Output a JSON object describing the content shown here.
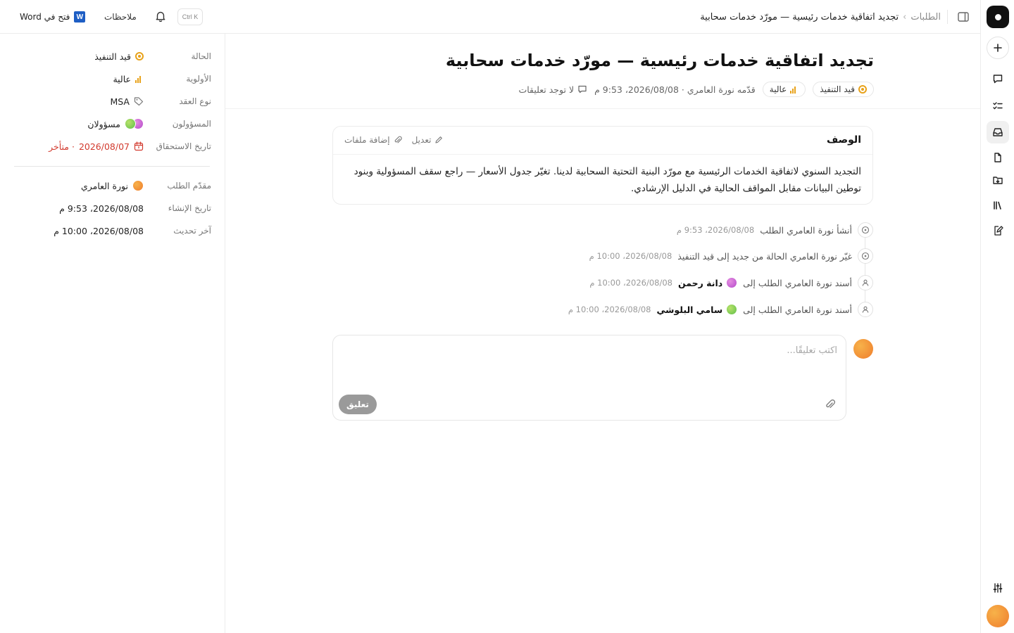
{
  "topbar": {
    "breadcrumb_parent": "الطلبات",
    "breadcrumb_separator": "›",
    "breadcrumb_current": "تجديد اتفاقية خدمات رئيسية — مورّد خدمات سحابية",
    "shortcut_hint": "Ctrl K",
    "notes_label": "ملاحظات",
    "open_in_word_label": "فتح في Word",
    "word_icon_letter": "W"
  },
  "properties": {
    "status": {
      "label": "الحالة",
      "value": "قيد التنفيذ",
      "color": "#e8a21a"
    },
    "priority": {
      "label": "الأولوية",
      "value": "عالية"
    },
    "contract_type": {
      "label": "نوع العقد",
      "value": "MSA"
    },
    "assignees": {
      "label": "المسؤولون",
      "value": "مسؤولان"
    },
    "due_date": {
      "label": "تاريخ الاستحقاق",
      "value": "2026/08/07",
      "overdue": "· متأخر",
      "color": "#d23a2e"
    },
    "requester": {
      "label": "مقدّم الطلب",
      "value": "نورة العامري"
    },
    "created": {
      "label": "تاريخ الإنشاء",
      "value": "2026/08/08، 9:53 م"
    },
    "updated": {
      "label": "آخر تحديث",
      "value": "2026/08/08، 10:00 م"
    }
  },
  "header": {
    "title": "تجديد اتفاقية خدمات رئيسية — مورّد خدمات سحابية",
    "status_pill": "قيد التنفيذ",
    "priority_pill": "عالية",
    "submitted_by": "قدّمه نورة العامري · 2026/08/08، 9:53 م",
    "comments_count": "لا توجد تعليقات"
  },
  "description": {
    "heading": "الوصف",
    "edit_label": "تعديل",
    "attach_label": "إضافة ملفات",
    "body": "التجديد السنوي لاتفاقية الخدمات الرئيسية مع مورّد البنية التحتية السحابية لدينا. تغيّر جدول الأسعار — راجع سقف المسؤولية وبنود توطين البيانات مقابل المواقف الحالية في الدليل الإرشادي."
  },
  "activity": [
    {
      "icon": "status-circle-icon",
      "text": "أنشأ نورة العامري الطلب",
      "who": "",
      "time": "2026/08/08، 9:53 م"
    },
    {
      "icon": "status-circle-icon",
      "text": "غيّر نورة العامري الحالة من جديد إلى قيد التنفيذ",
      "who": "",
      "time": "2026/08/08، 10:00 م"
    },
    {
      "icon": "user-icon",
      "text": "أسند نورة العامري الطلب إلى",
      "who": "دانة رحمن",
      "time": "2026/08/08، 10:00 م"
    },
    {
      "icon": "user-icon",
      "text": "أسند نورة العامري الطلب إلى",
      "who": "سامي البلوشي",
      "time": "2026/08/08، 10:00 م"
    }
  ],
  "composer": {
    "placeholder": "اكتب تعليقًا...",
    "submit_label": "تعليق"
  },
  "rail": {
    "icons": [
      "logo-icon",
      "add-icon",
      "chat-icon",
      "tasks-icon",
      "inbox-icon",
      "document-icon",
      "folder-download-icon",
      "library-icon",
      "edit-document-icon",
      "settings-sliders-icon"
    ],
    "active": "inbox-icon"
  }
}
